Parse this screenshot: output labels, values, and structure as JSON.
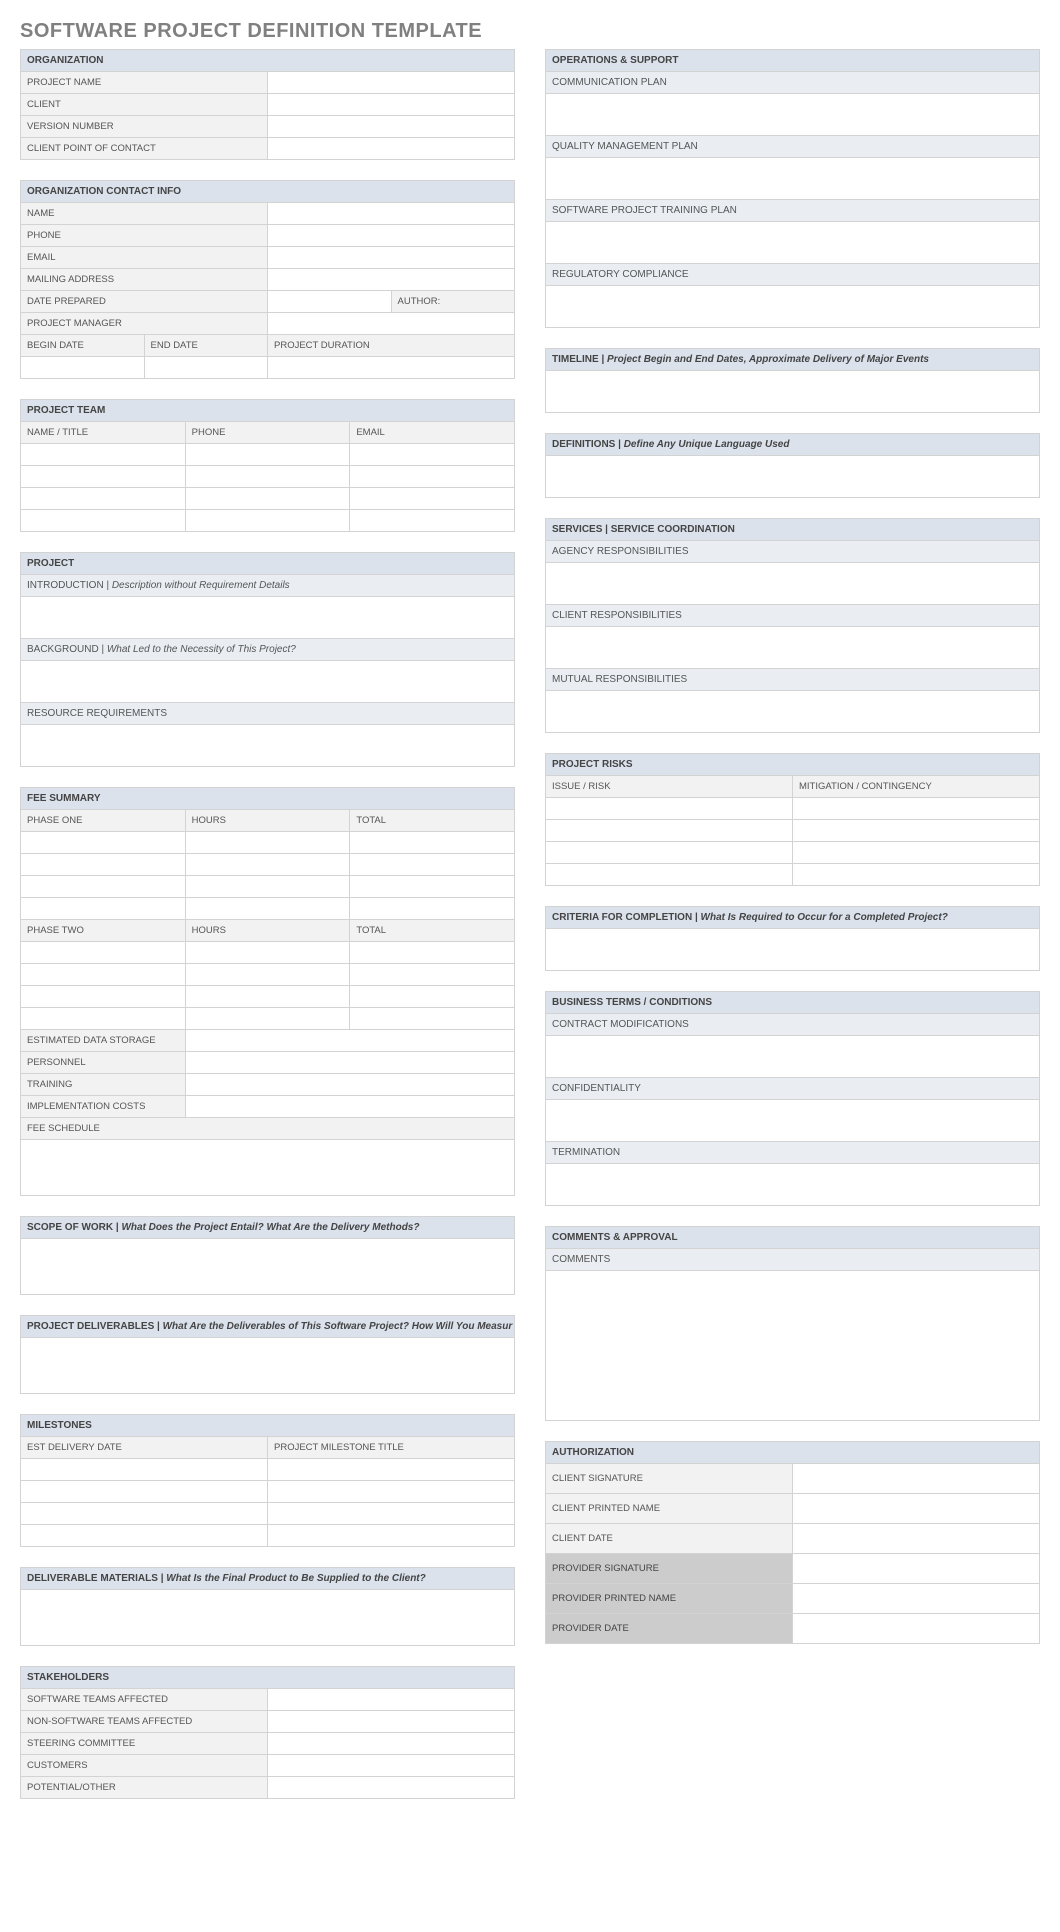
{
  "title": "SOFTWARE PROJECT DEFINITION TEMPLATE",
  "organization": {
    "header": "ORGANIZATION",
    "project_name": "PROJECT NAME",
    "client": "CLIENT",
    "version_number": "VERSION NUMBER",
    "client_poc": "CLIENT POINT OF CONTACT"
  },
  "contact": {
    "header": "ORGANIZATION CONTACT INFO",
    "name": "NAME",
    "phone": "PHONE",
    "email": "EMAIL",
    "mailing": "MAILING ADDRESS",
    "date_prepared": "DATE PREPARED",
    "author": "AUTHOR:",
    "project_manager": "PROJECT MANAGER",
    "begin_date": "BEGIN DATE",
    "end_date": "END DATE",
    "project_duration": "PROJECT DURATION"
  },
  "team": {
    "header": "PROJECT TEAM",
    "name_title": "NAME / TITLE",
    "phone": "PHONE",
    "email": "EMAIL"
  },
  "project": {
    "header": "PROJECT",
    "intro_label": "INTRODUCTION | ",
    "intro_desc": "Description without Requirement Details",
    "background_label": "BACKGROUND | ",
    "background_desc": "What Led to the Necessity of This Project?",
    "resource_req": "RESOURCE REQUIREMENTS"
  },
  "fee": {
    "header": "FEE SUMMARY",
    "phase_one": "PHASE ONE",
    "phase_two": "PHASE TWO",
    "hours": "HOURS",
    "total": "TOTAL",
    "storage": "ESTIMATED DATA STORAGE",
    "personnel": "PERSONNEL",
    "training": "TRAINING",
    "impl": "IMPLEMENTATION COSTS",
    "schedule": "FEE SCHEDULE"
  },
  "scope": {
    "label": "SCOPE OF WORK  | ",
    "desc": "What Does the Project Entail? What Are the Delivery Methods?"
  },
  "deliverables": {
    "label": "PROJECT DELIVERABLES  | ",
    "desc": "What Are the Deliverables of This Software Project? How Will You Measur"
  },
  "milestones": {
    "header": "MILESTONES",
    "est_date": "EST DELIVERY DATE",
    "title": "PROJECT MILESTONE TITLE"
  },
  "materials": {
    "label": "DELIVERABLE MATERIALS  | ",
    "desc": "What Is the Final Product to Be Supplied to the Client?"
  },
  "stakeholders": {
    "header": "STAKEHOLDERS",
    "software": "SOFTWARE TEAMS AFFECTED",
    "nonsoftware": "NON-SOFTWARE TEAMS AFFECTED",
    "steering": "STEERING COMMITTEE",
    "customers": "CUSTOMERS",
    "potential": "POTENTIAL/OTHER"
  },
  "ops": {
    "header": "OPERATIONS & SUPPORT",
    "comm": "COMMUNICATION PLAN",
    "quality": "QUALITY MANAGEMENT PLAN",
    "training": "SOFTWARE PROJECT TRAINING PLAN",
    "regulatory": "REGULATORY COMPLIANCE"
  },
  "timeline": {
    "label": "TIMELINE | ",
    "desc": "Project Begin and End Dates, Approximate Delivery of Major Events"
  },
  "definitions": {
    "label": "DEFINITIONS | ",
    "desc": "Define Any Unique Language Used"
  },
  "services": {
    "header": "SERVICES | SERVICE COORDINATION",
    "agency": "AGENCY RESPONSIBILITIES",
    "client": "CLIENT RESPONSIBILITIES",
    "mutual": "MUTUAL RESPONSIBILITIES"
  },
  "risks": {
    "header": "PROJECT RISKS",
    "issue": "ISSUE / RISK",
    "mitigation": "MITIGATION / CONTINGENCY"
  },
  "criteria": {
    "label": "CRITERIA FOR COMPLETION  |  ",
    "desc": "What Is Required to Occur for a Completed Project?"
  },
  "terms": {
    "header": "BUSINESS TERMS / CONDITIONS",
    "mod": "CONTRACT MODIFICATIONS",
    "conf": "CONFIDENTIALITY",
    "term": "TERMINATION"
  },
  "comments": {
    "header": "COMMENTS & APPROVAL",
    "comments": "COMMENTS"
  },
  "auth": {
    "header": "AUTHORIZATION",
    "client_sig": "CLIENT SIGNATURE",
    "client_name": "CLIENT PRINTED NAME",
    "client_date": "CLIENT DATE",
    "provider_sig": "PROVIDER SIGNATURE",
    "provider_name": "PROVIDER PRINTED NAME",
    "provider_date": "PROVIDER DATE"
  }
}
